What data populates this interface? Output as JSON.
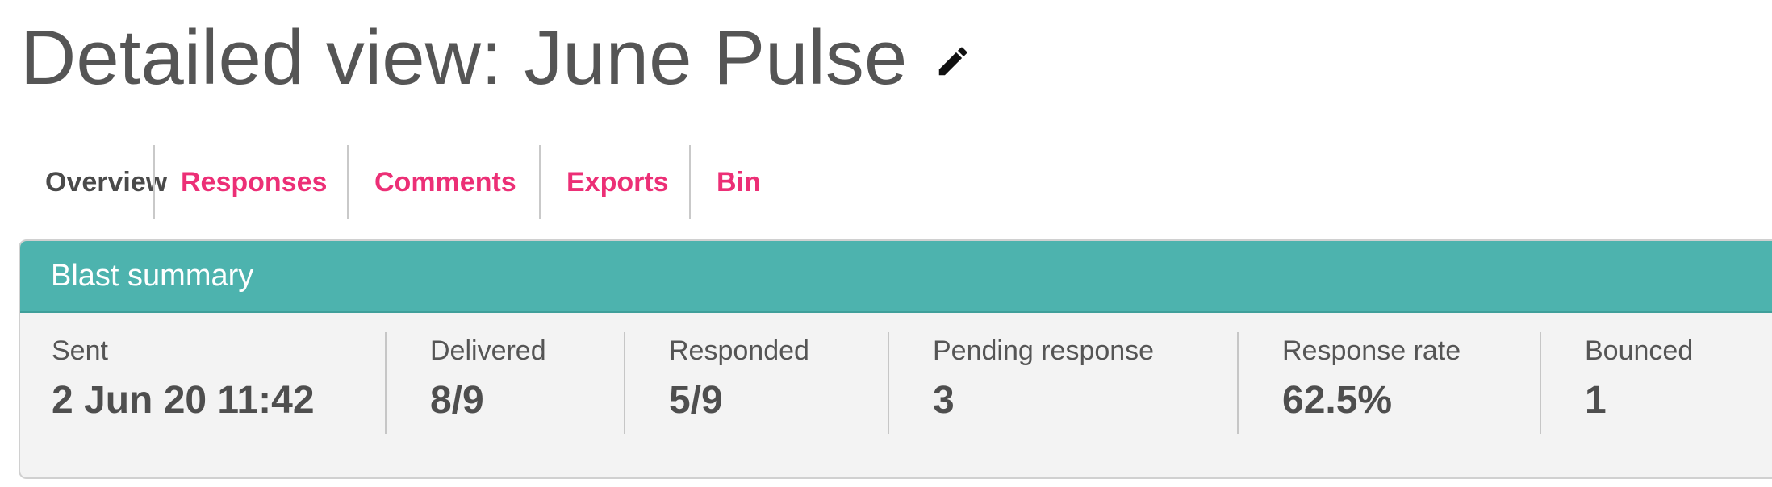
{
  "header": {
    "title": "Detailed view: June Pulse",
    "edit_icon": "pencil-icon"
  },
  "tabs": [
    {
      "label": "Overview",
      "active": true
    },
    {
      "label": "Responses",
      "active": false
    },
    {
      "label": "Comments",
      "active": false
    },
    {
      "label": "Exports",
      "active": false
    },
    {
      "label": "Bin",
      "active": false
    }
  ],
  "summary": {
    "title": "Blast summary",
    "stats": [
      {
        "label": "Sent",
        "value": "2 Jun 20 11:42"
      },
      {
        "label": "Delivered",
        "value": "8/9"
      },
      {
        "label": "Responded",
        "value": "5/9"
      },
      {
        "label": "Pending response",
        "value": "3"
      },
      {
        "label": "Response rate",
        "value": "62.5%"
      },
      {
        "label": "Bounced",
        "value": "1"
      }
    ]
  },
  "colors": {
    "accent": "#ec2f76",
    "panel_header": "#4db3ae",
    "panel_background": "#f3f3f3",
    "text": "#555555"
  }
}
